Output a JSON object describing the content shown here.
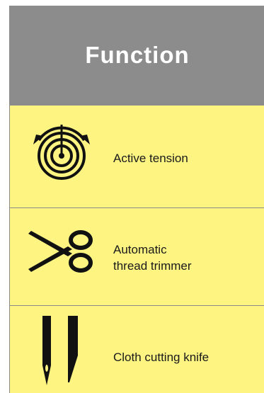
{
  "header": {
    "title": "Function"
  },
  "rows": [
    {
      "label": "Active tension",
      "icon": "tension-dial-icon"
    },
    {
      "label_lines": [
        "Automatic",
        "thread trimmer"
      ],
      "icon": "scissors-icon"
    },
    {
      "label": "Cloth cutting knife",
      "icon": "needle-knife-icon"
    }
  ],
  "colors": {
    "header_bg": "#8c8c8c",
    "row_bg": "#fdf482",
    "border": "#8a8a8a",
    "text": "#1a1a1a"
  }
}
